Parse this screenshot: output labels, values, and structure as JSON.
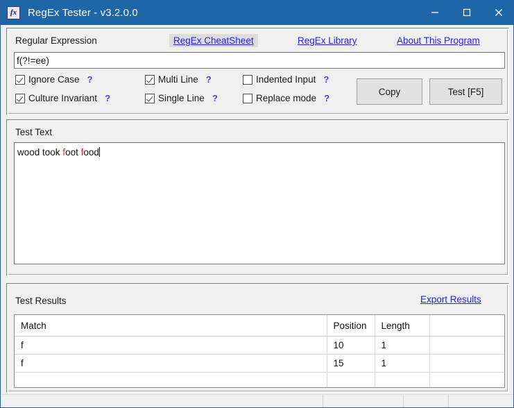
{
  "window": {
    "title": "RegEx Tester - v3.2.0.0",
    "icon": "fx-app-icon",
    "icon_glyph": "fx",
    "titlebar_color": "#1f66a8",
    "controls": {
      "minimize": "minimize-icon",
      "maximize": "maximize-icon",
      "close": "close-icon"
    }
  },
  "regex_panel": {
    "label": "Regular Expression",
    "links": [
      {
        "label": "RegEx CheatSheet",
        "focused": true
      },
      {
        "label": "RegEx Library",
        "focused": false
      },
      {
        "label": "About This Program",
        "focused": false
      }
    ],
    "input": {
      "value": "f(?!=ee)",
      "placeholder": ""
    },
    "options": [
      {
        "label": "Ignore Case",
        "checked": true,
        "help": "?"
      },
      {
        "label": "Culture Invariant",
        "checked": true,
        "help": "?"
      },
      {
        "label": "Multi Line",
        "checked": true,
        "help": "?"
      },
      {
        "label": "Single Line",
        "checked": true,
        "help": "?"
      },
      {
        "label": "Indented Input",
        "checked": false,
        "help": "?"
      },
      {
        "label": "Replace mode",
        "checked": false,
        "help": "?"
      }
    ],
    "buttons": {
      "copy": "Copy",
      "test": "Test [F5]"
    }
  },
  "test_text_panel": {
    "label": "Test Text",
    "content": {
      "segments": [
        {
          "text": "wood took ",
          "match": false
        },
        {
          "text": "f",
          "match": true
        },
        {
          "text": "oot ",
          "match": false
        },
        {
          "text": "f",
          "match": true
        },
        {
          "text": "ood",
          "match": false
        }
      ],
      "plain": "wood took foot food",
      "caret_at_end": true,
      "match_color": "#ee2222"
    }
  },
  "results_panel": {
    "label": "Test Results",
    "export_link": "Export Results",
    "table": {
      "columns": [
        "Match",
        "Position",
        "Length",
        ""
      ],
      "rows": [
        [
          "f",
          "10",
          "1",
          ""
        ],
        [
          "f",
          "15",
          "1",
          ""
        ],
        [
          "",
          "",
          "",
          ""
        ],
        [
          "",
          "",
          "",
          ""
        ]
      ]
    }
  },
  "statusbar": {
    "cells": [
      "",
      "",
      "",
      ""
    ]
  }
}
